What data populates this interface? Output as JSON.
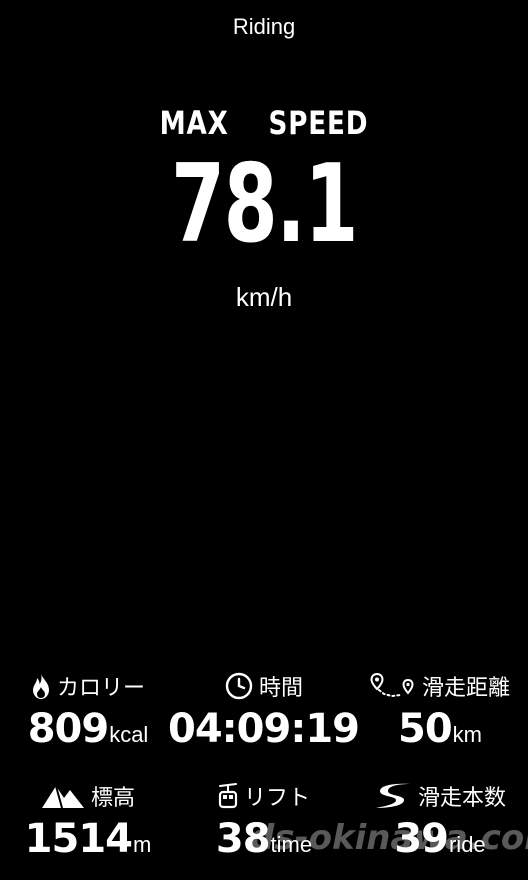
{
  "header": {
    "title": "Riding"
  },
  "hero": {
    "label": "MAX    SPEED",
    "value": "78.1",
    "unit": "km/h"
  },
  "stats": [
    {
      "id": "calories",
      "icon": "flame-icon",
      "label": "カロリー",
      "value": "809",
      "unit": "kcal"
    },
    {
      "id": "time",
      "icon": "clock-icon",
      "label": "時間",
      "value": "04:09:19",
      "unit": ""
    },
    {
      "id": "distance",
      "icon": "route-icon",
      "label": "滑走距離",
      "value": "50",
      "unit": "km"
    },
    {
      "id": "altitude",
      "icon": "mountain-icon",
      "label": "標高",
      "value": "1514",
      "unit": "m"
    },
    {
      "id": "lift",
      "icon": "gondola-icon",
      "label": "リフト",
      "value": "38",
      "unit": "time"
    },
    {
      "id": "rides",
      "icon": "slope-icon",
      "label": "滑走本数",
      "value": "39",
      "unit": "ride"
    }
  ],
  "watermark": "ds-okinawa.com",
  "colors": {
    "background": "#000000",
    "text": "#ffffff"
  }
}
